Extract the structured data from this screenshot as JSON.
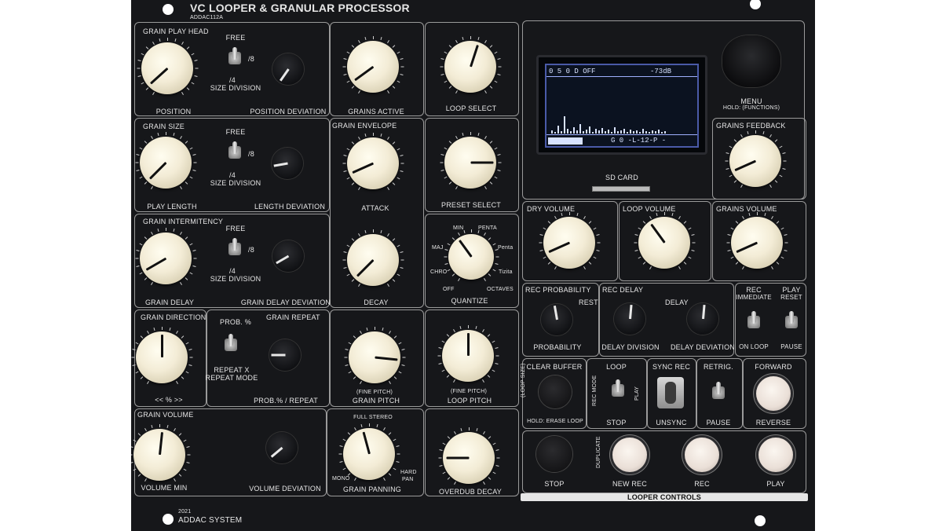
{
  "header": {
    "title": "VC LOOPER & GRANULAR PROCESSOR",
    "model": "ADDAC112A",
    "year": "2021",
    "brand": "ADDAC SYSTEM"
  },
  "grain_play_head": {
    "title": "GRAIN PLAY HEAD",
    "knob": "POSITION",
    "switch_top": "FREE",
    "switch_right": "/8",
    "switch_bottom": "/4",
    "switch_label": "SIZE DIVISION",
    "dev": "POSITION DEVIATION"
  },
  "grain_size": {
    "title": "GRAIN SIZE",
    "knob": "PLAY LENGTH",
    "switch_top": "FREE",
    "switch_right": "/8",
    "switch_bottom": "/4",
    "switch_label": "SIZE DIVISION",
    "dev": "LENGTH DEVIATION"
  },
  "grain_intermitency": {
    "title": "GRAIN INTERMITENCY",
    "knob": "GRAIN DELAY",
    "switch_top": "FREE",
    "switch_right": "/8",
    "switch_bottom": "/4",
    "switch_label": "SIZE DIVISION",
    "dev": "GRAIN DELAY DEVIATION"
  },
  "grain_direction": {
    "title": "GRAIN DIRECTION",
    "scale": "<<   %   >>"
  },
  "grain_repeat": {
    "switch_top": "PROB. %",
    "title": "GRAIN REPEAT",
    "switch_bottom": "REPEAT X",
    "switch_label": "REPEAT MODE",
    "dev": "PROB.% / REPEAT"
  },
  "grain_volume": {
    "title": "GRAIN VOLUME",
    "knob": "VOLUME MIN",
    "dev": "VOLUME DEVIATION"
  },
  "grains_active": {
    "label": "GRAINS ACTIVE"
  },
  "grain_envelope": {
    "title": "GRAIN ENVELOPE",
    "attack": "ATTACK",
    "decay": "DECAY"
  },
  "grain_pitch": {
    "fine": "(FINE PITCH)",
    "label": "GRAIN PITCH"
  },
  "grain_panning": {
    "top": "FULL STEREO",
    "left": "MONO",
    "right1": "HARD",
    "right2": "PAN",
    "label": "GRAIN PANNING"
  },
  "loop_select": {
    "label": "LOOP SELECT"
  },
  "preset_select": {
    "label": "PRESET SELECT"
  },
  "quantize": {
    "label": "QUANTIZE",
    "min": "MIN",
    "penta_top": "PENTA",
    "maj": "MAJ",
    "penta": "Penta",
    "chro": "CHRO",
    "tizita": "Tizita",
    "off": "OFF",
    "octaves": "OCTAVES"
  },
  "loop_pitch": {
    "fine": "(FINE PITCH)",
    "label": "LOOP PITCH"
  },
  "overdub": {
    "label": "OVERDUB DECAY"
  },
  "display": {
    "top_left": "0 5 0 D OFF",
    "top_right": "-73dB",
    "bottom": "G 0 -L-12-P -",
    "sd_card": "SD CARD"
  },
  "menu": {
    "label": "MENU",
    "sub": "HOLD: (FUNCTIONS)"
  },
  "grains_feedback": {
    "label": "GRAINS FEEDBACK"
  },
  "dry_volume": {
    "label": "DRY VOLUME"
  },
  "loop_volume": {
    "label": "LOOP VOLUME"
  },
  "grains_volume": {
    "label": "GRAINS VOLUME"
  },
  "rec_probability": {
    "title": "REC PROBABILITY",
    "rest": "REST",
    "knob": "PROBABILITY"
  },
  "rec_delay": {
    "title": "REC DELAY",
    "delay": "DELAY",
    "k1": "DELAY DIVISION",
    "k2": "DELAY DEVIATION"
  },
  "rec_play": {
    "rec": "REC",
    "immediate": "IMMEDIATE",
    "play": "PLAY",
    "reset": "RESET",
    "on_loop": "ON LOOP",
    "pause": "PAUSE"
  },
  "clear_buffer": {
    "title": "CLEAR BUFFER",
    "side": "(LOOP SIZE)",
    "bottom": "HOLD: ERASE LOOP"
  },
  "loop_mode": {
    "title": "LOOP",
    "side": "REC MODE",
    "play": "PLAY",
    "stop": "STOP"
  },
  "sync_rec": {
    "title": "SYNC REC",
    "unsync": "UNSYNC"
  },
  "retrig": {
    "title": "RETRIG.",
    "pause": "PAUSE"
  },
  "forward": {
    "title": "FORWARD",
    "reverse": "REVERSE"
  },
  "looper": {
    "stop": "STOP",
    "duplicate": "DUPLICATE",
    "new_rec": "NEW REC",
    "rec": "REC",
    "play": "PLAY",
    "controls": "LOOPER CONTROLS"
  },
  "knob_values": {
    "position": 0.06,
    "play_length": 0.05,
    "grain_delay": 0.1,
    "grain_direction": 0.5,
    "volume_min": 0.52,
    "grains_active": 0.08,
    "attack": 0.12,
    "decay": 0.05,
    "grain_pitch": 0.82,
    "grain_panning": 0.45,
    "loop_select": 0.56,
    "preset_select": 0.8,
    "quantize": 0.38,
    "loop_pitch": 0.5,
    "overdub_decay": 0.2,
    "grains_feedback": 0.12,
    "dry_volume": 0.12,
    "loop_volume": 0.38,
    "grains_volume": 0.12
  }
}
